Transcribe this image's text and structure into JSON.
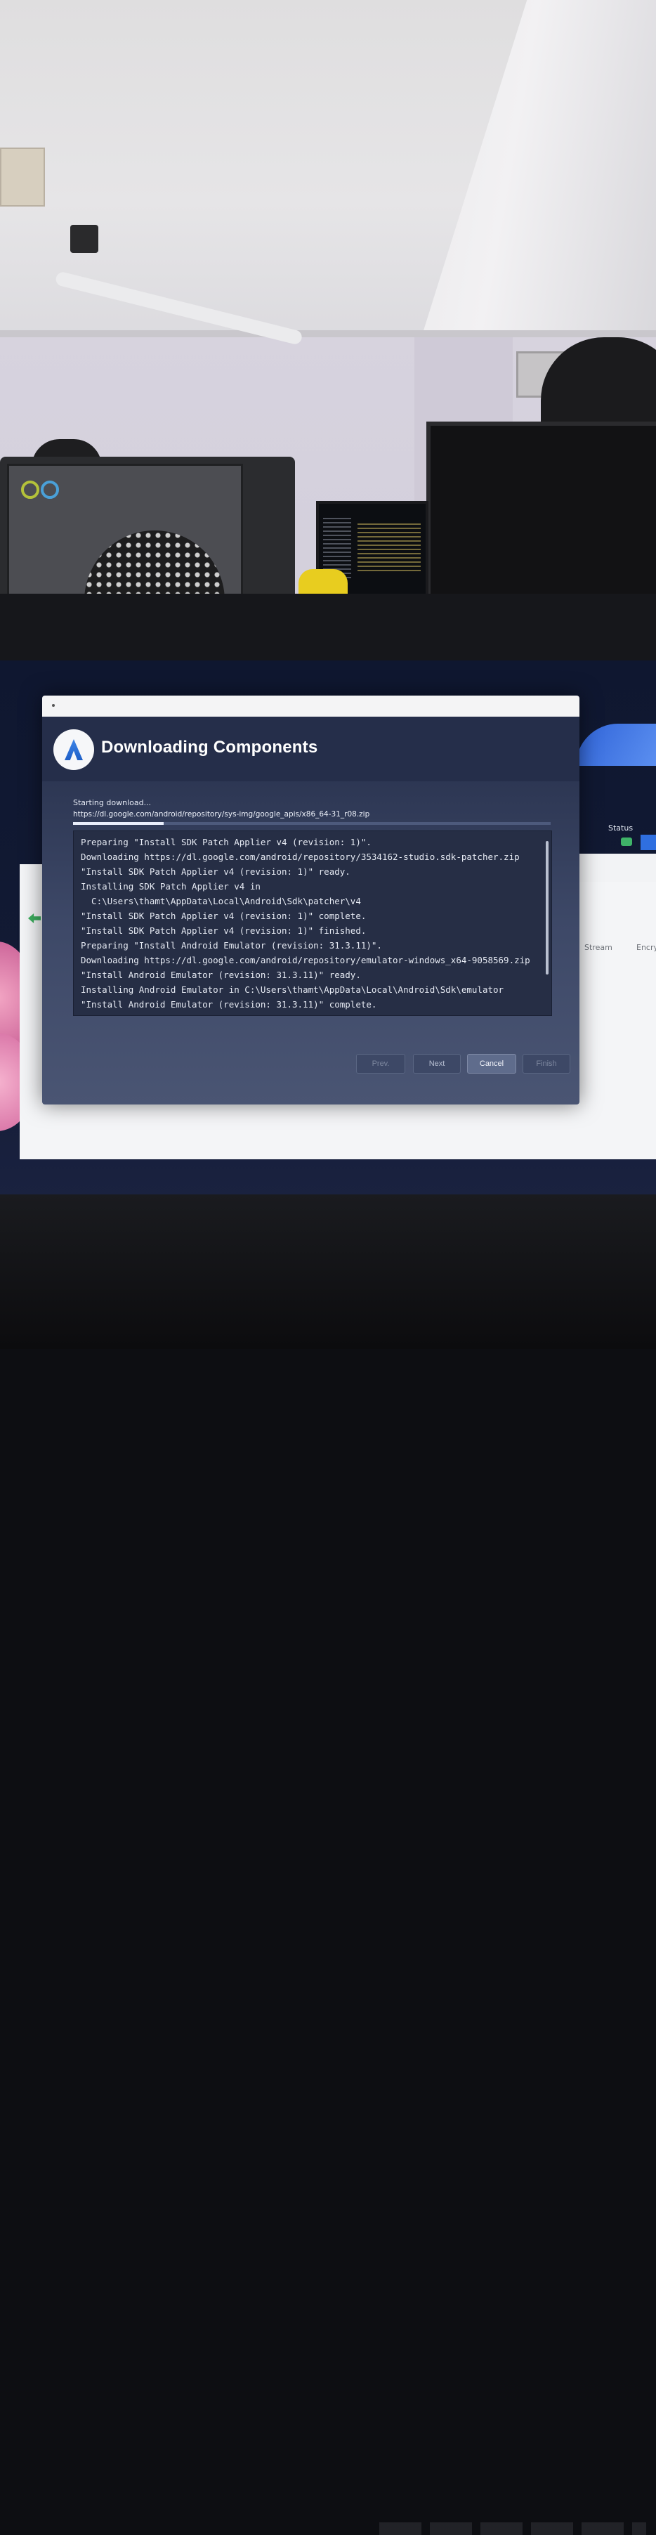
{
  "dialog": {
    "title": "Downloading Components",
    "status": "Starting download...",
    "url": "https://dl.google.com/android/repository/sys-img/google_apis/x86_64-31_r08.zip",
    "progress": 0.19,
    "log": [
      "Preparing \"Install SDK Patch Applier v4 (revision: 1)\".",
      "Downloading https://dl.google.com/android/repository/3534162-studio.sdk-patcher.zip",
      "\"Install SDK Patch Applier v4 (revision: 1)\" ready.",
      "Installing SDK Patch Applier v4 in",
      "  C:\\Users\\thamt\\AppData\\Local\\Android\\Sdk\\patcher\\v4",
      "\"Install SDK Patch Applier v4 (revision: 1)\" complete.",
      "\"Install SDK Patch Applier v4 (revision: 1)\" finished.",
      "Preparing \"Install Android Emulator (revision: 31.3.11)\".",
      "Downloading https://dl.google.com/android/repository/emulator-windows_x64-9058569.zip",
      "\"Install Android Emulator (revision: 31.3.11)\" ready.",
      "Installing Android Emulator in C:\\Users\\thamt\\AppData\\Local\\Android\\Sdk\\emulator",
      "\"Install Android Emulator (revision: 31.3.11)\" complete."
    ],
    "buttons": {
      "prev": "Prev.",
      "next": "Next",
      "cancel": "Cancel",
      "finish": "Finish"
    }
  },
  "background_window": {
    "status_label": "Status",
    "col_stream": "Stream",
    "col_encry": "Encry"
  }
}
